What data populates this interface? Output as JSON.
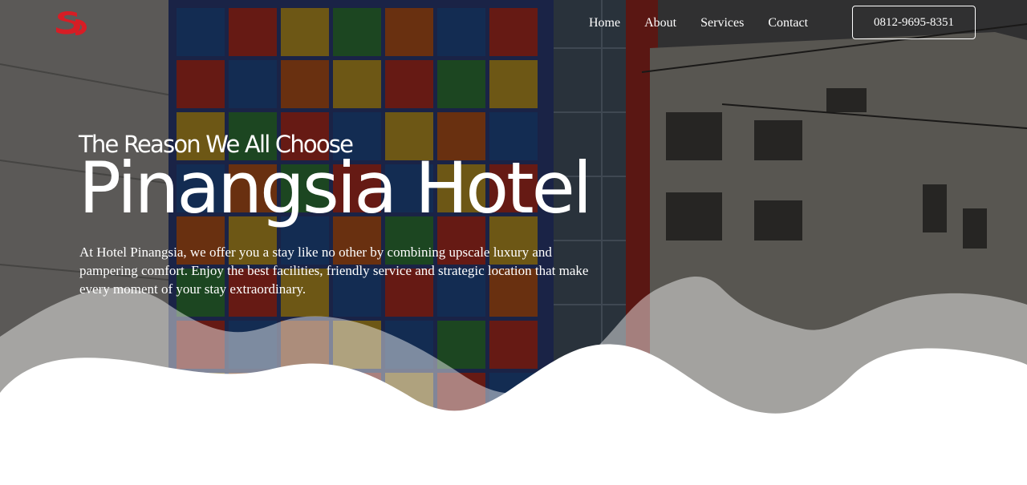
{
  "nav": {
    "items": [
      {
        "label": "Home"
      },
      {
        "label": "About"
      },
      {
        "label": "Services"
      },
      {
        "label": "Contact"
      }
    ],
    "phone": "0812-9695-8351"
  },
  "hero": {
    "subtitle": "The Reason We All Choose",
    "title": "Pinangsia Hotel",
    "description": "At Hotel Pinangsia, we offer you a stay like no other by combining upscale luxury and pampering comfort. Enjoy the best facilities, friendly service and strategic location that make every moment of your stay extraordinary."
  },
  "colors": {
    "brand_red": "#d71d25",
    "overlay": "#000000",
    "text": "#ffffff",
    "wave": "#ffffff"
  },
  "icons": {
    "logo": "hotel-logo-icon"
  }
}
